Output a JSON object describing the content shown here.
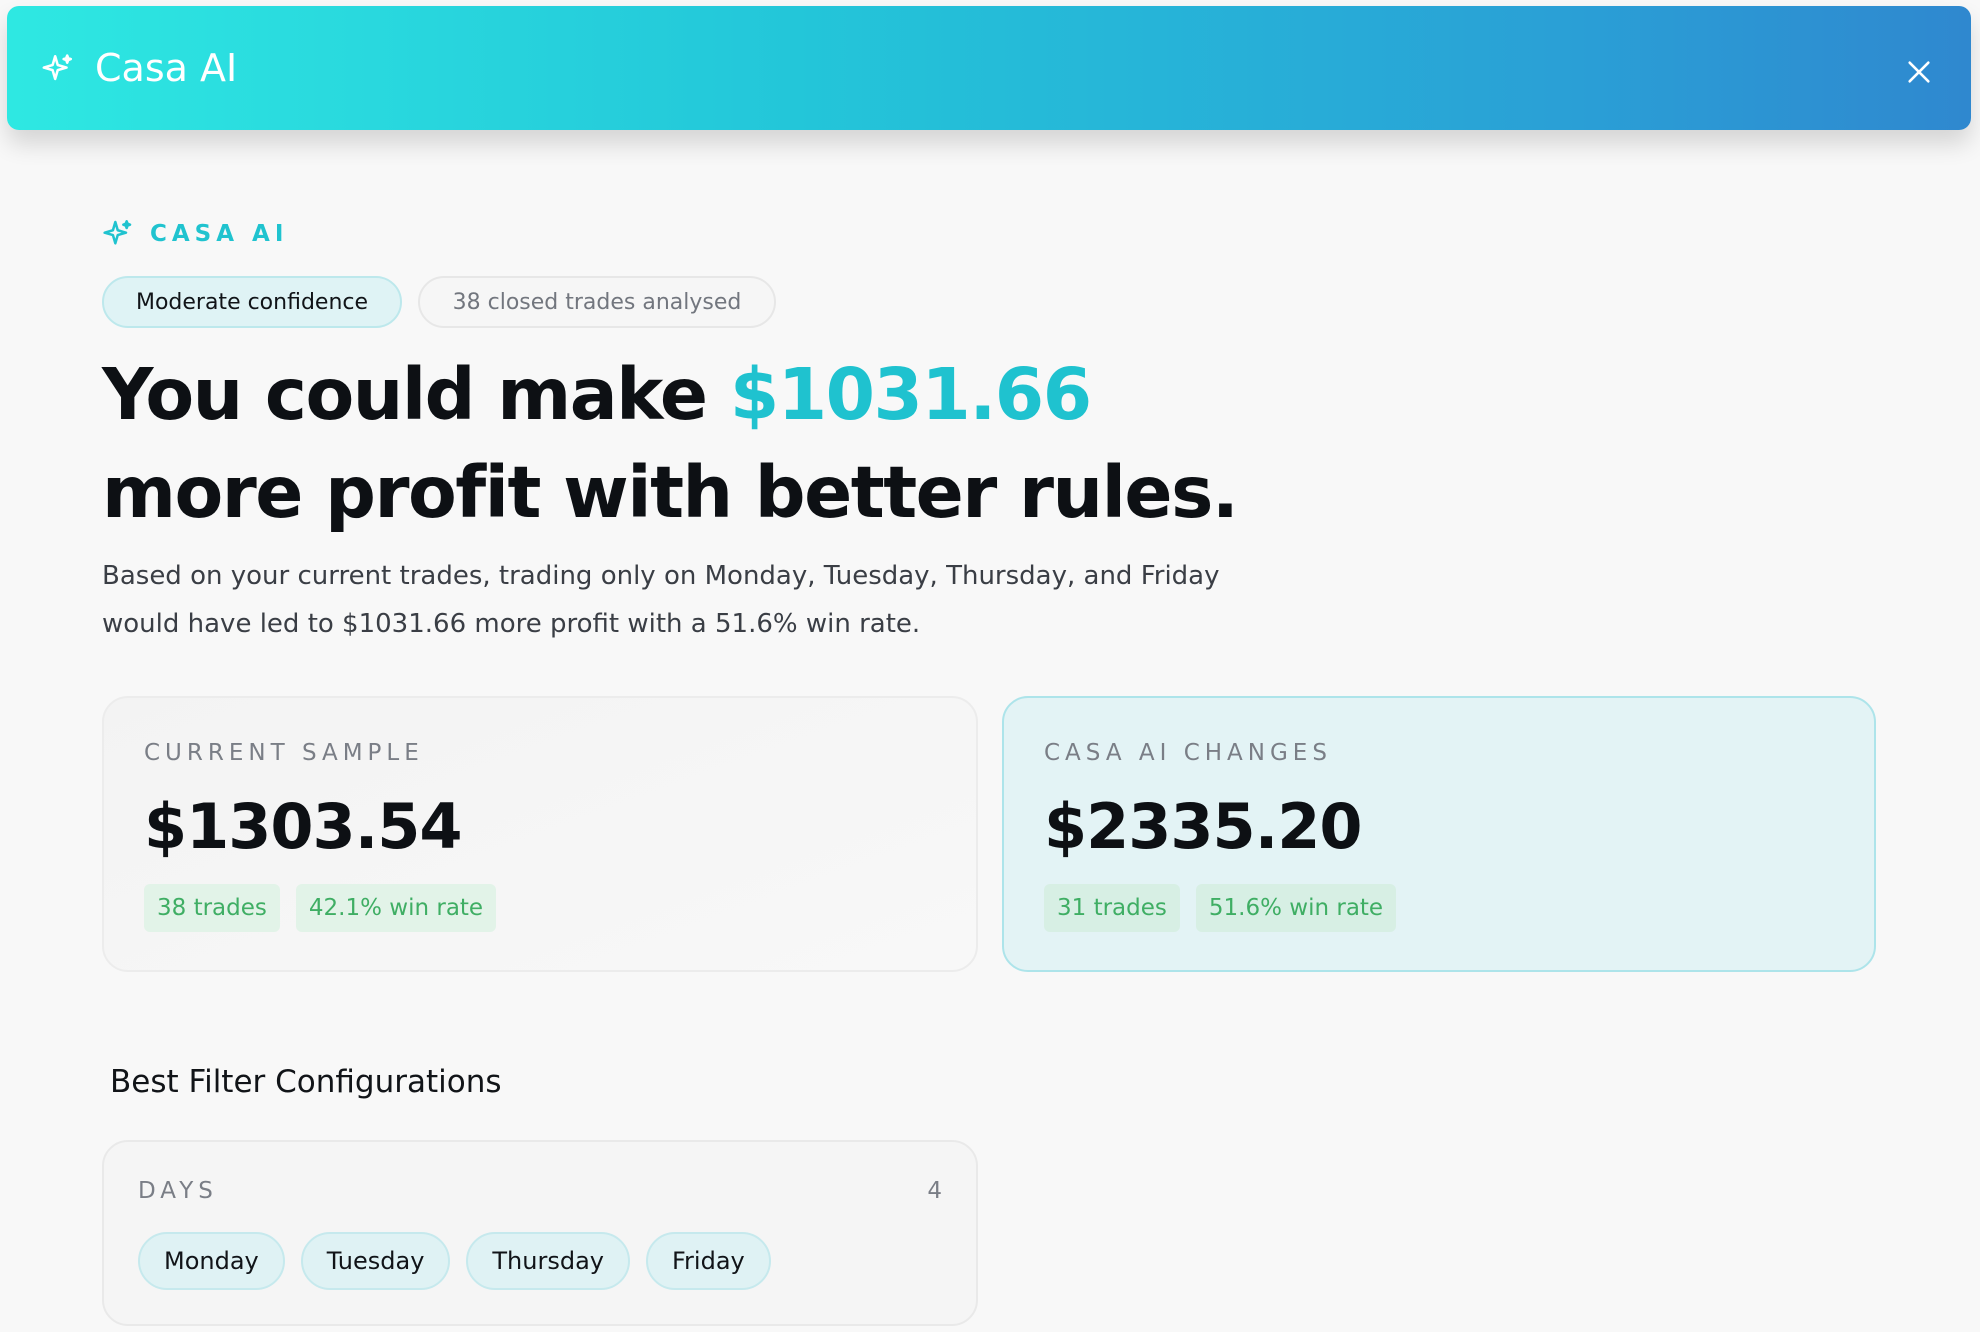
{
  "header": {
    "title": "Casa AI",
    "icon": "sparkle-icon",
    "close_icon": "close-icon"
  },
  "kicker": {
    "label": "CASA AI",
    "icon": "sparkle-icon"
  },
  "badges": {
    "confidence": "Moderate confidence",
    "trades_analysed": "38 closed trades analysed"
  },
  "headline": {
    "prefix": "You could make ",
    "amount": "$1031.66",
    "line2": "more profit with better rules."
  },
  "description": {
    "line1": "Based on your current trades, trading only on Monday, Tuesday, Thursday, and Friday",
    "line2": "would have led to $1031.66 more profit with a 51.6% win rate."
  },
  "cards": {
    "current": {
      "label": "CURRENT SAMPLE",
      "value": "$1303.54",
      "trades": "38 trades",
      "win_rate": "42.1% win rate"
    },
    "changes": {
      "label": "CASA AI CHANGES",
      "value": "$2335.20",
      "trades": "31 trades",
      "win_rate": "51.6% win rate"
    }
  },
  "filters": {
    "section_title": "Best Filter Configurations",
    "days": {
      "label": "DAYS",
      "count": "4",
      "items": [
        "Monday",
        "Tuesday",
        "Thursday",
        "Friday"
      ]
    }
  },
  "colors": {
    "accent": "#1fc2cf",
    "header_gradient_start": "#2ee8e2",
    "header_gradient_end": "#2f88cf",
    "stat_green": "#3fae64"
  }
}
